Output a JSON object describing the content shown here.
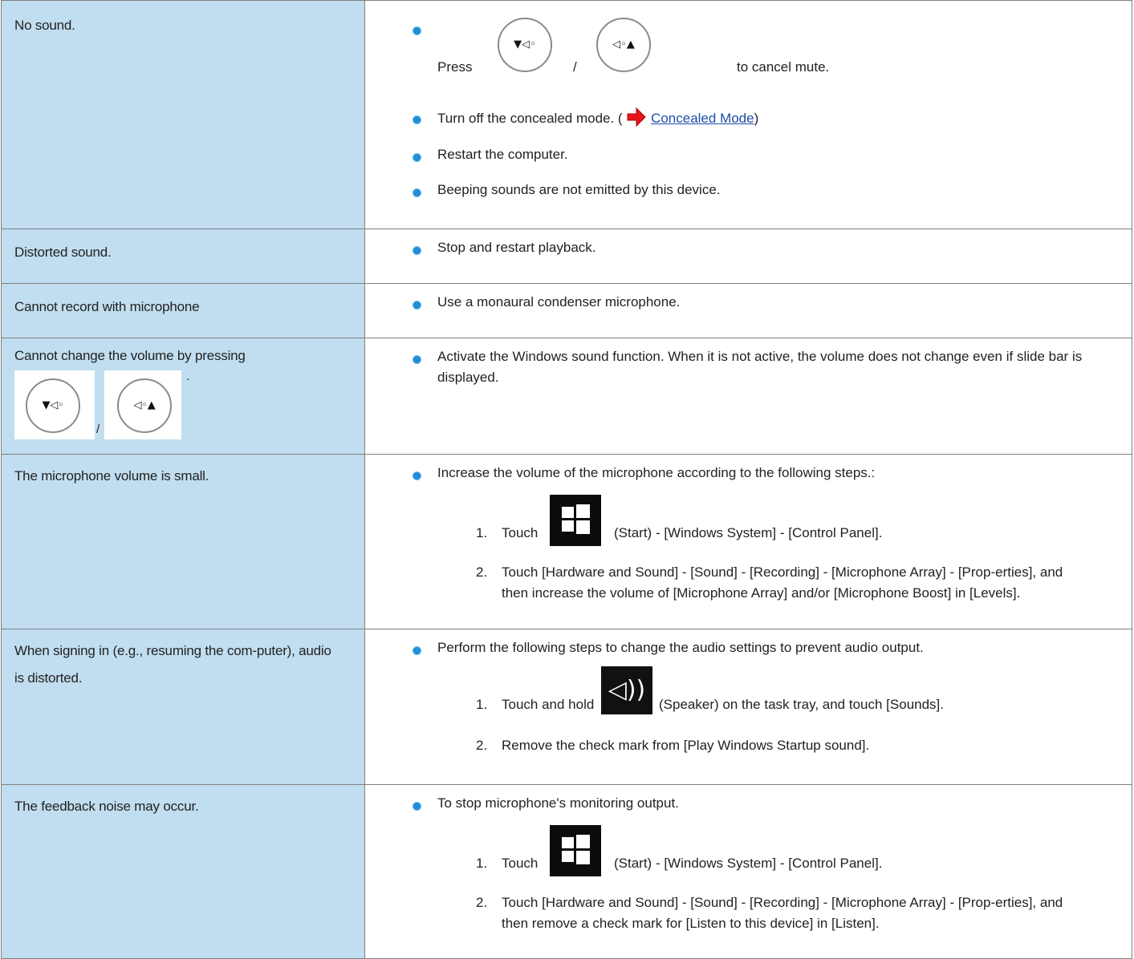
{
  "rows": [
    {
      "problem": "No sound.",
      "press": "Press",
      "slash": "/",
      "cancel": "to cancel mute.",
      "concealed_pre": "Turn off the concealed mode. (",
      "concealed_link": "Concealed Mode",
      "concealed_post": ")",
      "restart": "Restart the computer.",
      "beep": "Beeping sounds are not emitted by this device."
    },
    {
      "problem": "Distorted sound.",
      "solution": "Stop and restart playback."
    },
    {
      "problem": "Cannot record with microphone",
      "solution": "Use a monaural condenser microphone."
    },
    {
      "problem": "Cannot change the volume by pressing",
      "dot": ".",
      "slash": "/",
      "solution": "Activate the Windows sound function. When it is not active, the volume does not change even if slide bar is displayed."
    },
    {
      "problem": "The microphone volume is small.",
      "solution": "Increase the volume of the microphone according to the following steps.:",
      "step1_num": "1.",
      "step1_pre": "Touch",
      "step1_post": "(Start) - [Windows System] - [Control Panel].",
      "step2_num": "2.",
      "step2": "Touch [Hardware and Sound] - [Sound] - [Recording] - [Microphone Array] - [Prop-erties], and then increase the volume of [Microphone Array] and/or [Microphone Boost] in [Levels]."
    },
    {
      "problem": "When signing in (e.g., resuming the com-puter), audio is distorted.",
      "solution": "Perform the following steps to change the audio settings to prevent audio output.",
      "step1_num": "1.",
      "step1_pre": "Touch and hold",
      "step1_post": "(Speaker) on the task tray, and touch [Sounds].",
      "step2_num": "2.",
      "step2": "Remove the check mark from [Play Windows Startup sound]."
    },
    {
      "problem": "The feedback noise may occur.",
      "solution": "To stop microphone's monitoring output.",
      "step1_num": "1.",
      "step1_pre": "Touch",
      "step1_post": "(Start) - [Windows System] - [Control Panel].",
      "step2_num": "2.",
      "step2": "Touch [Hardware and Sound] - [Sound] - [Recording] - [Microphone Array] - [Prop-erties], and then remove a check mark for [Listen to this device] in [Listen]."
    }
  ],
  "icons": {
    "vol_down": "▾◁◦",
    "vol_up": "◁◦▴",
    "speaker": "◁))"
  }
}
